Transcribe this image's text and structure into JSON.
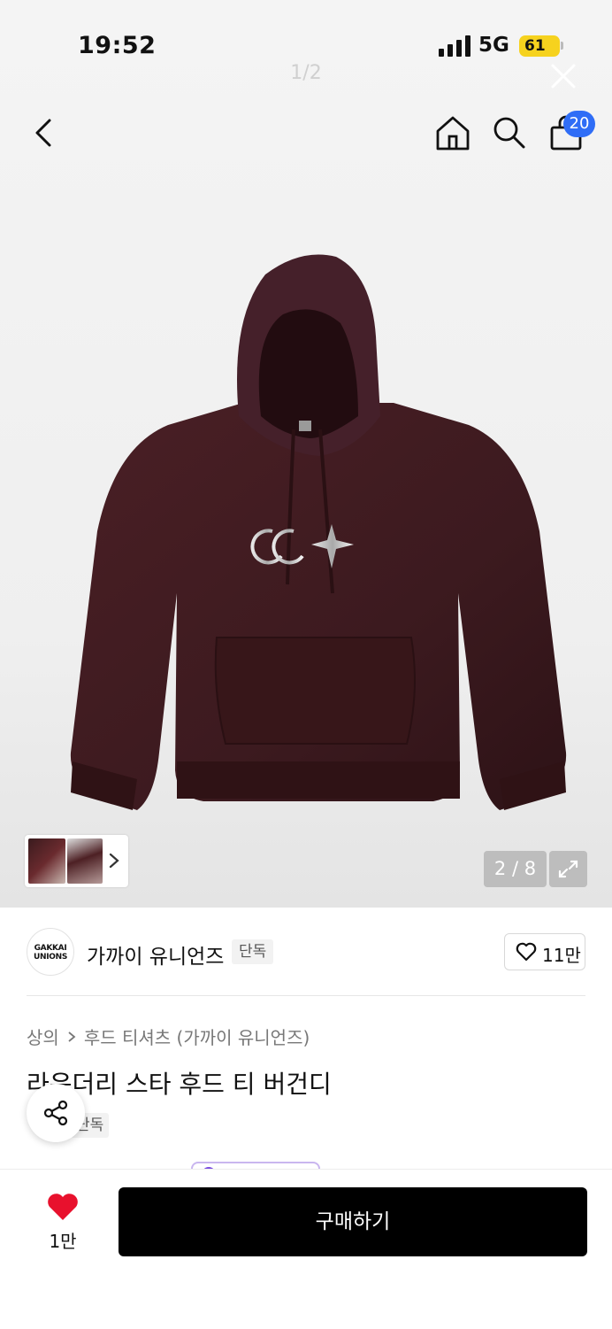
{
  "status_bar": {
    "time": "19:52",
    "network": "5G",
    "battery": "61"
  },
  "viewer": {
    "counter": "1/2"
  },
  "header": {
    "cart_badge": "20"
  },
  "gallery": {
    "counter": "2 / 8"
  },
  "brand": {
    "logo_line1": "GAKKAI",
    "logo_line2": "UNIONS",
    "name": "가까이 유니언즈",
    "tag": "단독",
    "like_count": "11만"
  },
  "product": {
    "breadcrumb": [
      "상의",
      "후드 티셔츠 (가까이 유니언즈)"
    ],
    "title": "라운더리 스타 후드 티 버건디",
    "tag": "단독"
  },
  "bottom": {
    "like_count": "1만",
    "buy_label": "구매하기"
  },
  "colors": {
    "accent_blue": "#2f6df6",
    "heart_red": "#e8112d",
    "hoodie": "#3c1a1f",
    "buy_button": "#000000"
  }
}
